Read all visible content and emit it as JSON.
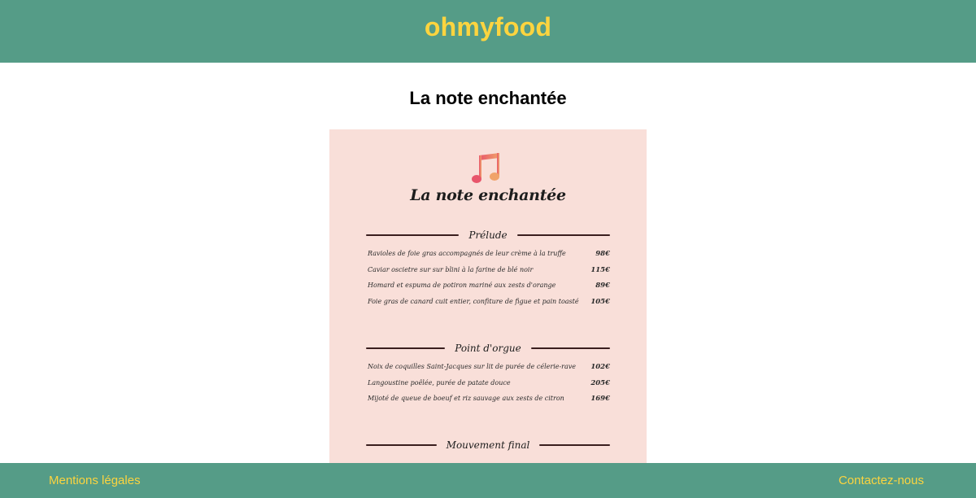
{
  "header": {
    "brand": "ohmyfood"
  },
  "main": {
    "title": "La note enchantée"
  },
  "menu": {
    "icon": "music-note-icon",
    "title": "La note enchantée",
    "sections": [
      {
        "name": "Prélude",
        "items": [
          {
            "name": "Ravioles de foie gras accompagnés de leur crème à la truffe",
            "price": "98€"
          },
          {
            "name": "Caviar oscietre sur sur blini à la farine de blé noir",
            "price": "115€"
          },
          {
            "name": "Homard et espuma de potiron mariné aux zests d'orange",
            "price": "89€"
          },
          {
            "name": "Foie gras de canard cuit entier, confiture de figue et pain toasté",
            "price": "105€"
          }
        ]
      },
      {
        "name": "Point d'orgue",
        "items": [
          {
            "name": "Noix de coquilles Saint-Jacques sur lit de purée de célerie-rave",
            "price": "102€"
          },
          {
            "name": "Langoustine poêlée, purée de patate douce",
            "price": "205€"
          },
          {
            "name": "Mijoté de queue de boeuf et riz sauvage aux zests de citron",
            "price": "169€"
          }
        ]
      },
      {
        "name": "Mouvement final",
        "items": []
      }
    ]
  },
  "footer": {
    "legal": "Mentions légales",
    "contact": "Contactez-nous"
  },
  "colors": {
    "header_bg": "#559c87",
    "brand_yellow": "#fcd43f",
    "card_bg": "#f9dfd9",
    "rule_color": "#3a1e1e"
  }
}
